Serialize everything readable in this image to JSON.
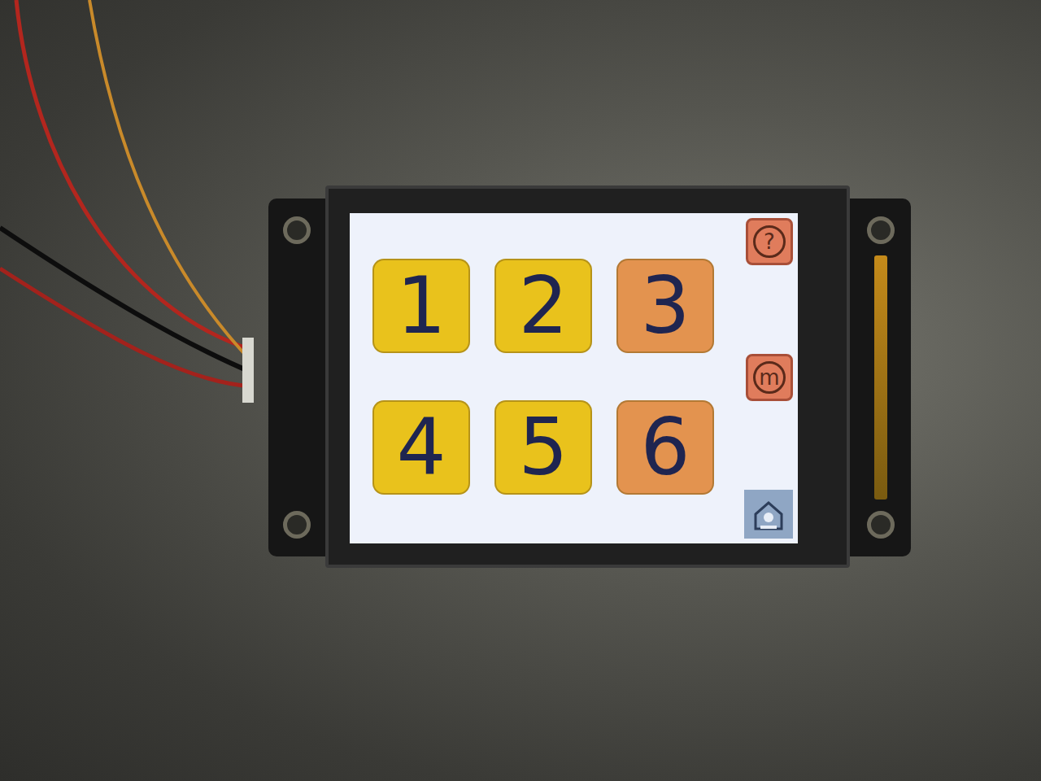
{
  "keys": [
    {
      "label": "1",
      "color": "#e9c21c"
    },
    {
      "label": "2",
      "color": "#e9c21c"
    },
    {
      "label": "3",
      "color": "#e3934f"
    },
    {
      "label": "4",
      "color": "#e9c21c"
    },
    {
      "label": "5",
      "color": "#e9c21c"
    },
    {
      "label": "6",
      "color": "#e3934f"
    }
  ],
  "side_buttons": [
    {
      "label": "?"
    },
    {
      "label": "m"
    }
  ]
}
